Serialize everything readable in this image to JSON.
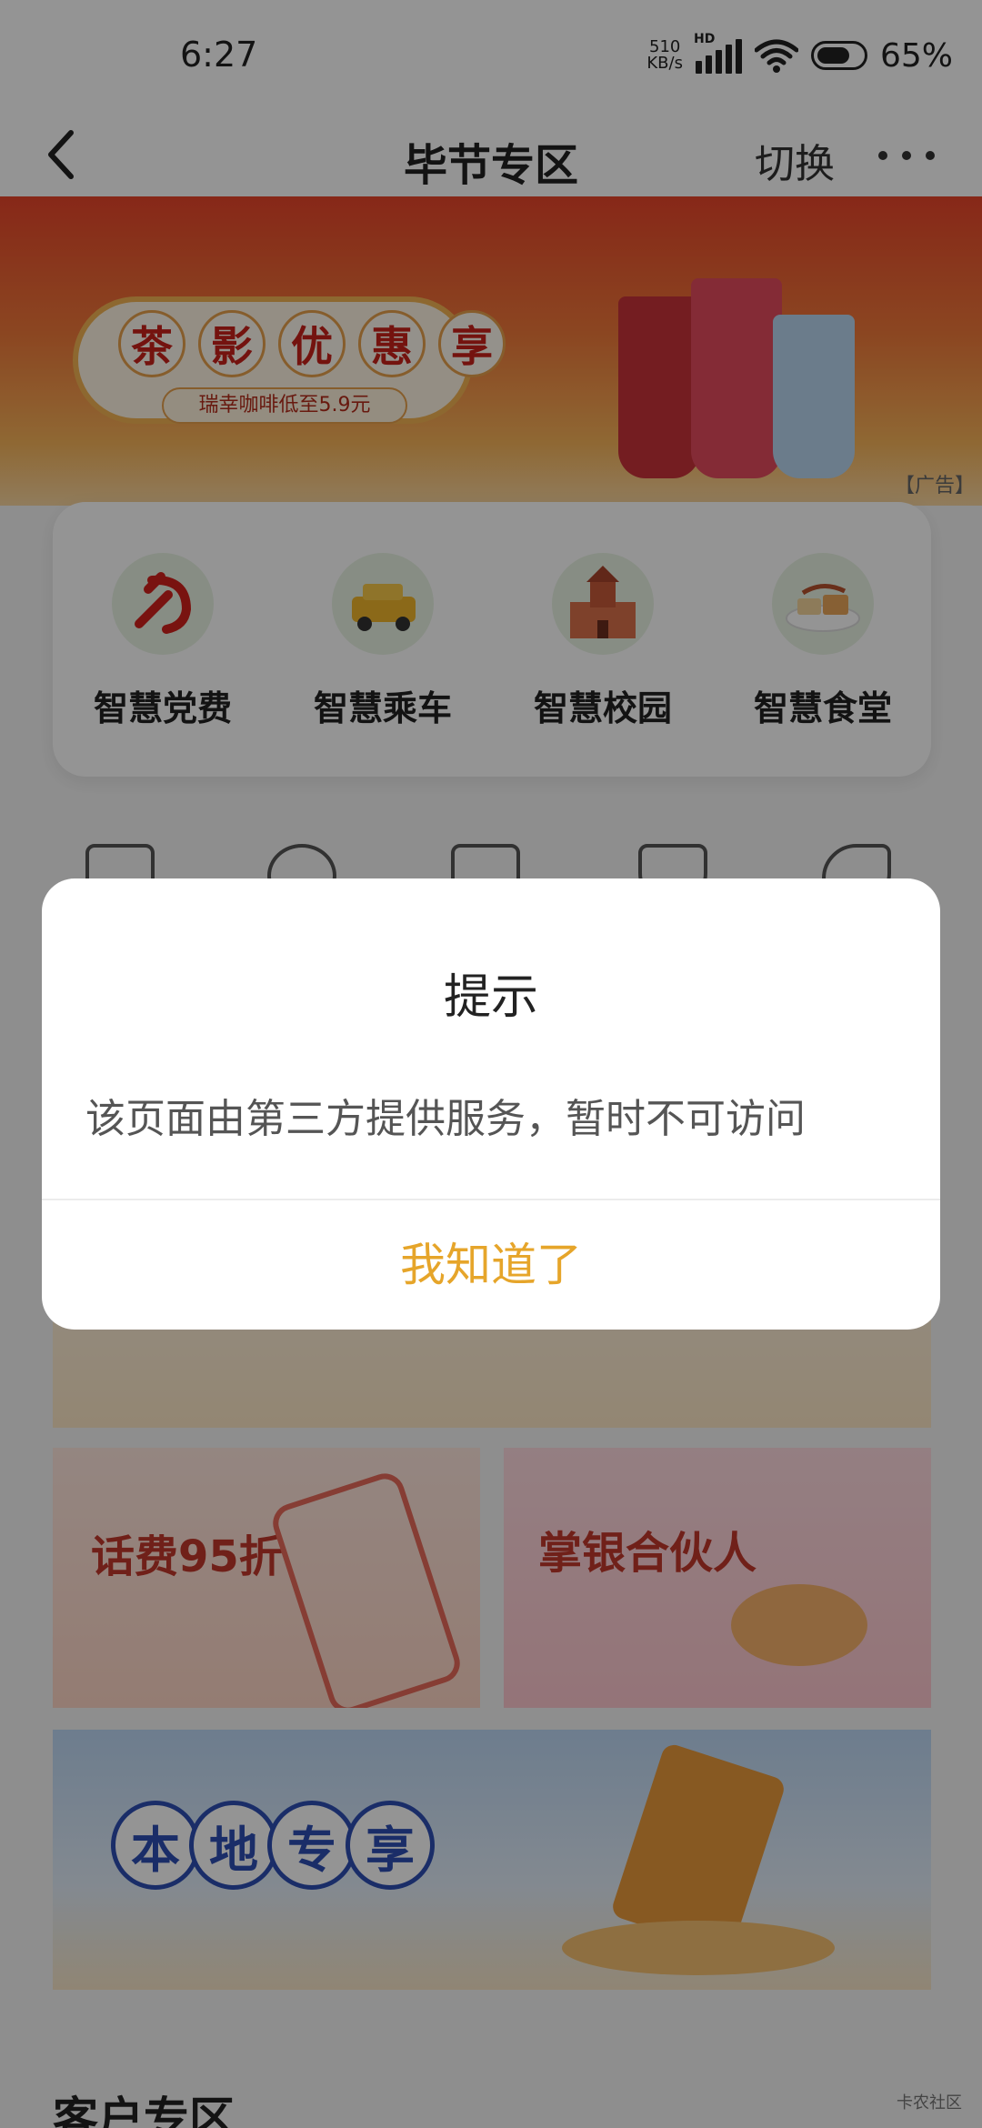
{
  "status_bar": {
    "time": "6:27",
    "net_speed_value": "510",
    "net_speed_unit": "KB/s",
    "hd": "HD",
    "battery": "65%"
  },
  "header": {
    "title": "毕节专区",
    "switch_label": "切换"
  },
  "banner": {
    "chars": [
      "茶",
      "影",
      "优",
      "惠",
      "享"
    ],
    "subtitle": "瑞幸咖啡低至5.9元",
    "ad_tag": "【广告】"
  },
  "services": [
    {
      "label": "智慧党费",
      "icon": "party-emblem-icon"
    },
    {
      "label": "智慧乘车",
      "icon": "taxi-icon"
    },
    {
      "label": "智慧校园",
      "icon": "school-icon"
    },
    {
      "label": "智慧食堂",
      "icon": "food-plate-icon"
    }
  ],
  "tiles": {
    "left_title": "话费95折",
    "right_title": "掌银合伙人"
  },
  "local_banner": {
    "chars": [
      "本",
      "地",
      "专",
      "享"
    ]
  },
  "section_title": "客户专区",
  "watermark": "卡农社区",
  "dialog": {
    "title": "提示",
    "message": "该页面由第三方提供服务，暂时不可访问",
    "confirm_label": "我知道了"
  },
  "colors": {
    "accent": "#e6a52a",
    "banner_red": "#e9452a"
  }
}
